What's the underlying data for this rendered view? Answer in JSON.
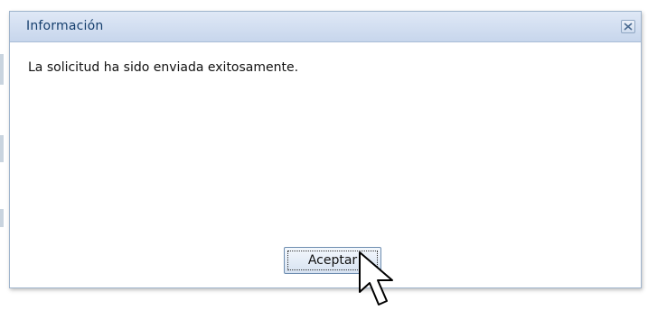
{
  "dialog": {
    "title": "Información",
    "message": "La solicitud ha sido enviada exitosamente.",
    "ok_label": "Aceptar",
    "close_icon": "close-icon"
  },
  "colors": {
    "titlebar_top": "#dfe8f6",
    "titlebar_bottom": "#c7d6ec",
    "title_text": "#153e6d",
    "dialog_border": "#9fb4cc",
    "button_border": "#6e8db0"
  },
  "cursor": {
    "icon": "mouse-pointer-icon"
  }
}
